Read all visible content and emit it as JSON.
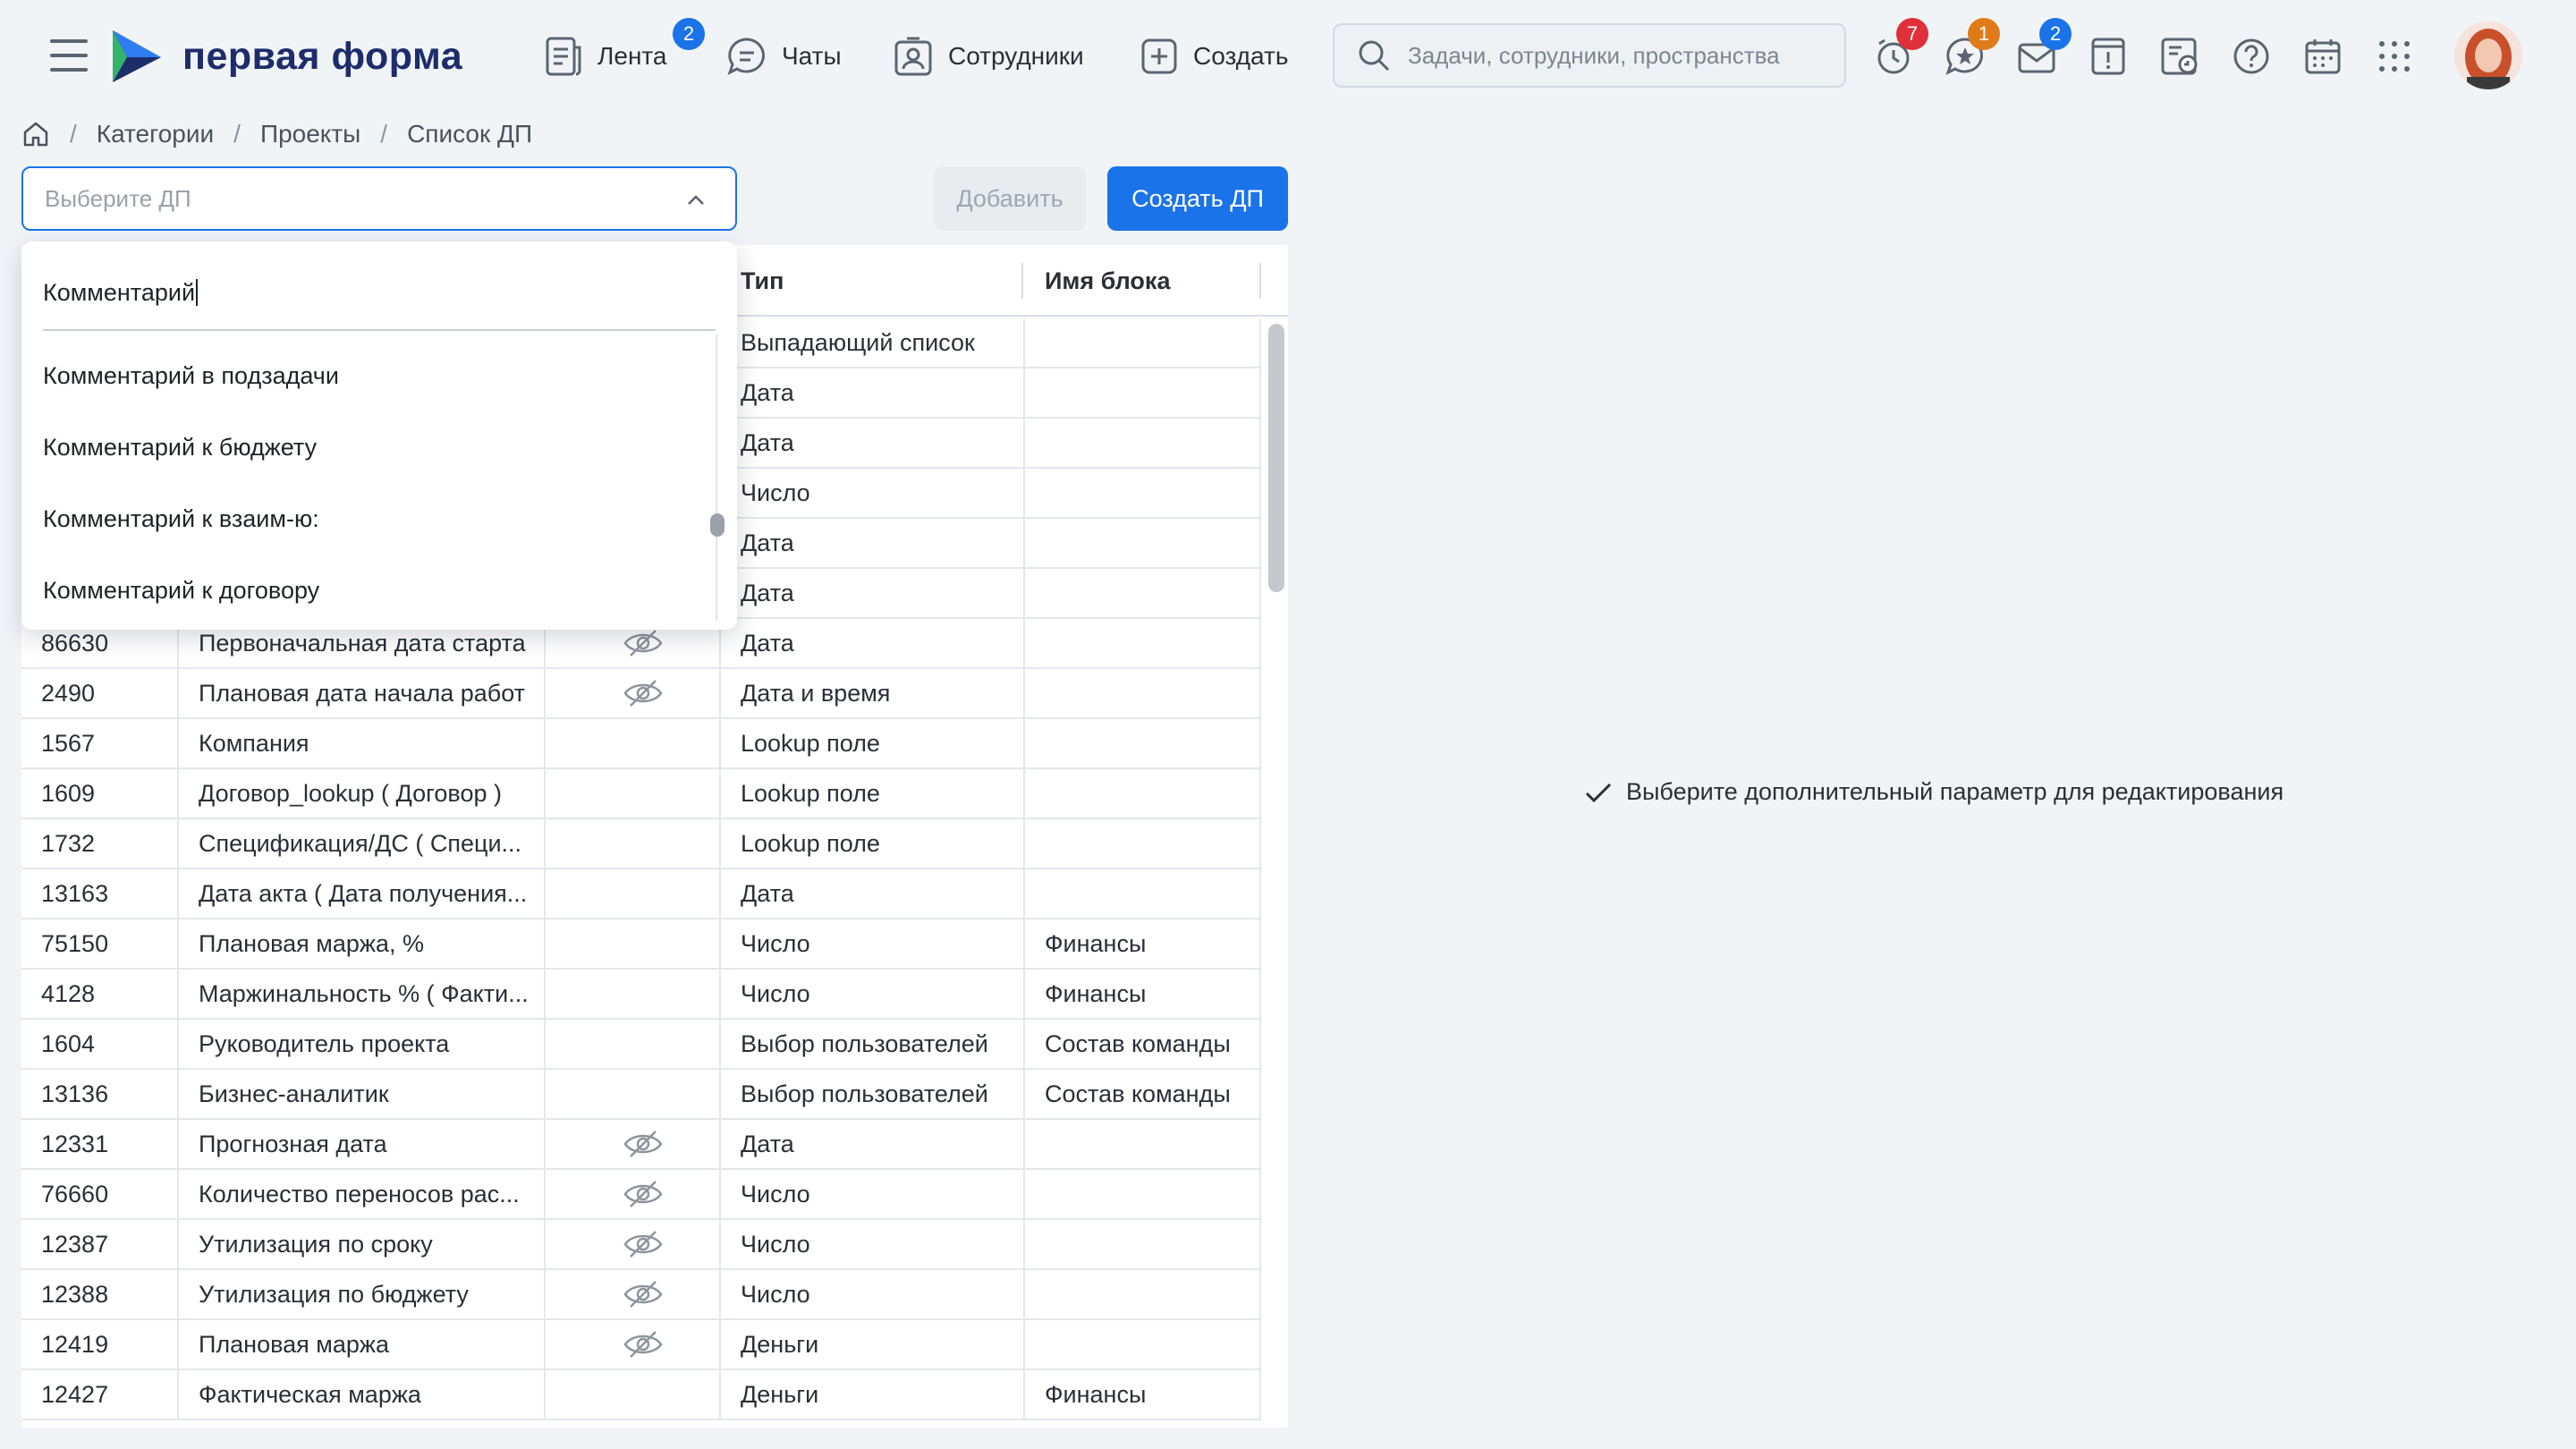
{
  "app": {
    "logo_text": "первая форма",
    "brand_color": "#1d2d6b",
    "accent_color": "#1a73e8"
  },
  "nav": [
    {
      "label": "Лента",
      "icon": "feed-icon",
      "badge": "2"
    },
    {
      "label": "Чаты",
      "icon": "chat-icon"
    },
    {
      "label": "Сотрудники",
      "icon": "employees-icon"
    },
    {
      "label": "Создать",
      "icon": "plus-icon"
    }
  ],
  "search": {
    "placeholder": "Задачи, сотрудники, пространства"
  },
  "header_icons": [
    {
      "name": "reminders-icon",
      "badge": "7",
      "badge_color": "#e0303a"
    },
    {
      "name": "favorites-icon",
      "badge": "1",
      "badge_color": "#e07b1a"
    },
    {
      "name": "mail-icon",
      "badge": "2",
      "badge_color": "#1a73e8"
    },
    {
      "name": "notice-icon"
    },
    {
      "name": "documents-icon"
    },
    {
      "name": "help-icon"
    },
    {
      "name": "calendar-icon"
    },
    {
      "name": "apps-grid-icon"
    }
  ],
  "breadcrumb": [
    "Категории",
    "Проекты",
    "Список ДП"
  ],
  "toolbar": {
    "select_placeholder": "Выберите ДП",
    "add_label": "Добавить",
    "create_label": "Создать ДП"
  },
  "dropdown": {
    "query": "Комментарий",
    "items": [
      "Комментарий в подзадачи",
      "Комментарий к бюджету",
      "Комментарий к взаим-ю:",
      "Комментарий к договору"
    ]
  },
  "table": {
    "headers": {
      "type": "Тип",
      "block": "Имя блока"
    },
    "hidden_top_rows": [
      {
        "type": "Выпадающий список",
        "block": ""
      },
      {
        "type": "Дата",
        "block": ""
      },
      {
        "type": "Дата",
        "block": ""
      },
      {
        "type": "Число",
        "block": ""
      },
      {
        "type": "Дата",
        "block": ""
      },
      {
        "type": "Дата",
        "block": ""
      }
    ],
    "rows": [
      {
        "id": "86630",
        "name": "Первоначальная дата старта",
        "hidden": true,
        "type": "Дата",
        "block": ""
      },
      {
        "id": "2490",
        "name": "Плановая дата начала работ",
        "hidden": true,
        "type": "Дата и время",
        "block": ""
      },
      {
        "id": "1567",
        "name": "Компания",
        "hidden": false,
        "type": "Lookup поле",
        "block": ""
      },
      {
        "id": "1609",
        "name": "Договор_lookup ( Договор )",
        "hidden": false,
        "type": "Lookup поле",
        "block": ""
      },
      {
        "id": "1732",
        "name": "Спецификация/ДС ( Специ...",
        "hidden": false,
        "type": "Lookup поле",
        "block": ""
      },
      {
        "id": "13163",
        "name": "Дата акта ( Дата получения...",
        "hidden": false,
        "type": "Дата",
        "block": ""
      },
      {
        "id": "75150",
        "name": "Плановая маржа, %",
        "hidden": false,
        "type": "Число",
        "block": "Финансы"
      },
      {
        "id": "4128",
        "name": "Маржинальность % ( Факти...",
        "hidden": false,
        "type": "Число",
        "block": "Финансы"
      },
      {
        "id": "1604",
        "name": "Руководитель проекта",
        "hidden": false,
        "type": "Выбор пользователей",
        "block": "Состав команды"
      },
      {
        "id": "13136",
        "name": "Бизнес-аналитик",
        "hidden": false,
        "type": "Выбор пользователей",
        "block": "Состав команды"
      },
      {
        "id": "12331",
        "name": "Прогнозная дата",
        "hidden": true,
        "type": "Дата",
        "block": ""
      },
      {
        "id": "76660",
        "name": "Количество переносов рас...",
        "hidden": true,
        "type": "Число",
        "block": ""
      },
      {
        "id": "12387",
        "name": "Утилизация по сроку",
        "hidden": true,
        "type": "Число",
        "block": ""
      },
      {
        "id": "12388",
        "name": "Утилизация по бюджету",
        "hidden": true,
        "type": "Число",
        "block": ""
      },
      {
        "id": "12419",
        "name": "Плановая маржа",
        "hidden": true,
        "type": "Деньги",
        "block": ""
      },
      {
        "id": "12427",
        "name": "Фактическая маржа",
        "hidden": false,
        "type": "Деньги",
        "block": "Финансы"
      }
    ]
  },
  "right_pane": {
    "hint": "Выберите дополнительный параметр для редактирования"
  }
}
